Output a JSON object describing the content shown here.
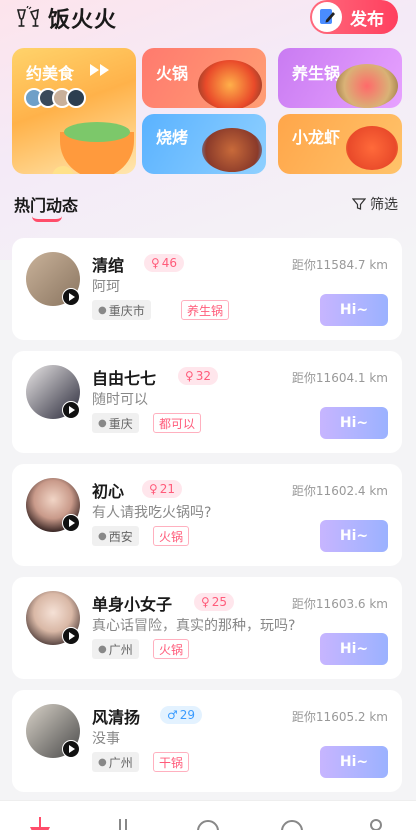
{
  "app": {
    "title": "饭火火",
    "publish_label": "发布"
  },
  "categories": [
    {
      "label": "约美食"
    },
    {
      "label": "火锅"
    },
    {
      "label": "养生锅"
    },
    {
      "label": "烧烤"
    },
    {
      "label": "小龙虾"
    }
  ],
  "section": {
    "title": "热门动态",
    "filter_label": "筛选"
  },
  "feed": [
    {
      "name": "清绾",
      "gender": "female",
      "age": "46",
      "distance": "距你11584.7 km",
      "signature": "阿珂",
      "city": "重庆市",
      "food": "养生锅",
      "hi": "Hi~"
    },
    {
      "name": "自由七七",
      "gender": "female",
      "age": "32",
      "distance": "距你11604.1 km",
      "signature": "随时可以",
      "city": "重庆",
      "food": "都可以",
      "hi": "Hi~"
    },
    {
      "name": "初心",
      "gender": "female",
      "age": "21",
      "distance": "距你11602.4 km",
      "signature": "有人请我吃火锅吗?",
      "city": "西安",
      "food": "火锅",
      "hi": "Hi~"
    },
    {
      "name": "单身小女子",
      "gender": "female",
      "age": "25",
      "distance": "距你11603.6 km",
      "signature": "真心话冒险，真实的那种，玩吗?",
      "city": "广州",
      "food": "火锅",
      "hi": "Hi~"
    },
    {
      "name": "风清扬",
      "gender": "male",
      "age": "29",
      "distance": "距你11605.2 km",
      "signature": "没事",
      "city": "广州",
      "food": "干锅",
      "hi": "Hi~"
    }
  ],
  "bottom_nav": {
    "items": [
      "home-icon",
      "food-icon",
      "plate-icon",
      "chat-icon",
      "profile-icon"
    ]
  },
  "colors": {
    "accent": "#ff4d6a",
    "hi_button": "#b0b4ff"
  }
}
